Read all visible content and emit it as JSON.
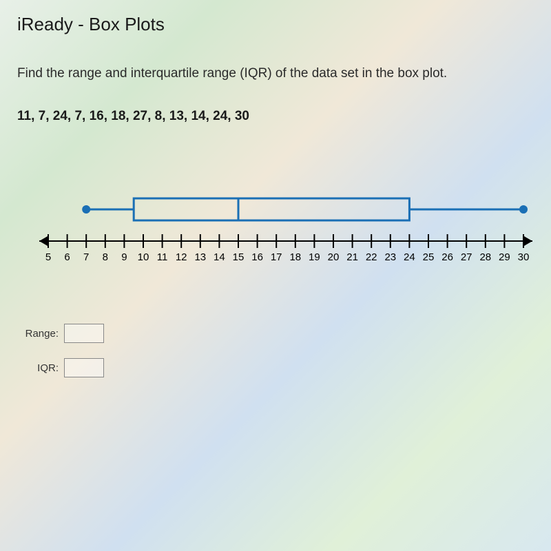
{
  "title": "iReady - Box Plots",
  "prompt": "Find the range and interquartile range (IQR) of the data set in the box plot.",
  "data_list": "11, 7, 24, 7, 16, 18, 27, 8, 13, 14, 24, 30",
  "answers": {
    "range_label": "Range:",
    "range_value": "",
    "iqr_label": "IQR:",
    "iqr_value": ""
  },
  "chart_data": {
    "type": "boxplot",
    "title": "",
    "xlabel": "",
    "ylabel": "",
    "axis_min": 5,
    "axis_max": 30,
    "ticks": [
      5,
      6,
      7,
      8,
      9,
      10,
      11,
      12,
      13,
      14,
      15,
      16,
      17,
      18,
      19,
      20,
      21,
      22,
      23,
      24,
      25,
      26,
      27,
      28,
      29,
      30
    ],
    "min": 7,
    "q1": 9.5,
    "median": 15,
    "q3": 24,
    "max": 30,
    "raw_data": [
      11,
      7,
      24,
      7,
      16,
      18,
      27,
      8,
      13,
      14,
      24,
      30
    ]
  }
}
